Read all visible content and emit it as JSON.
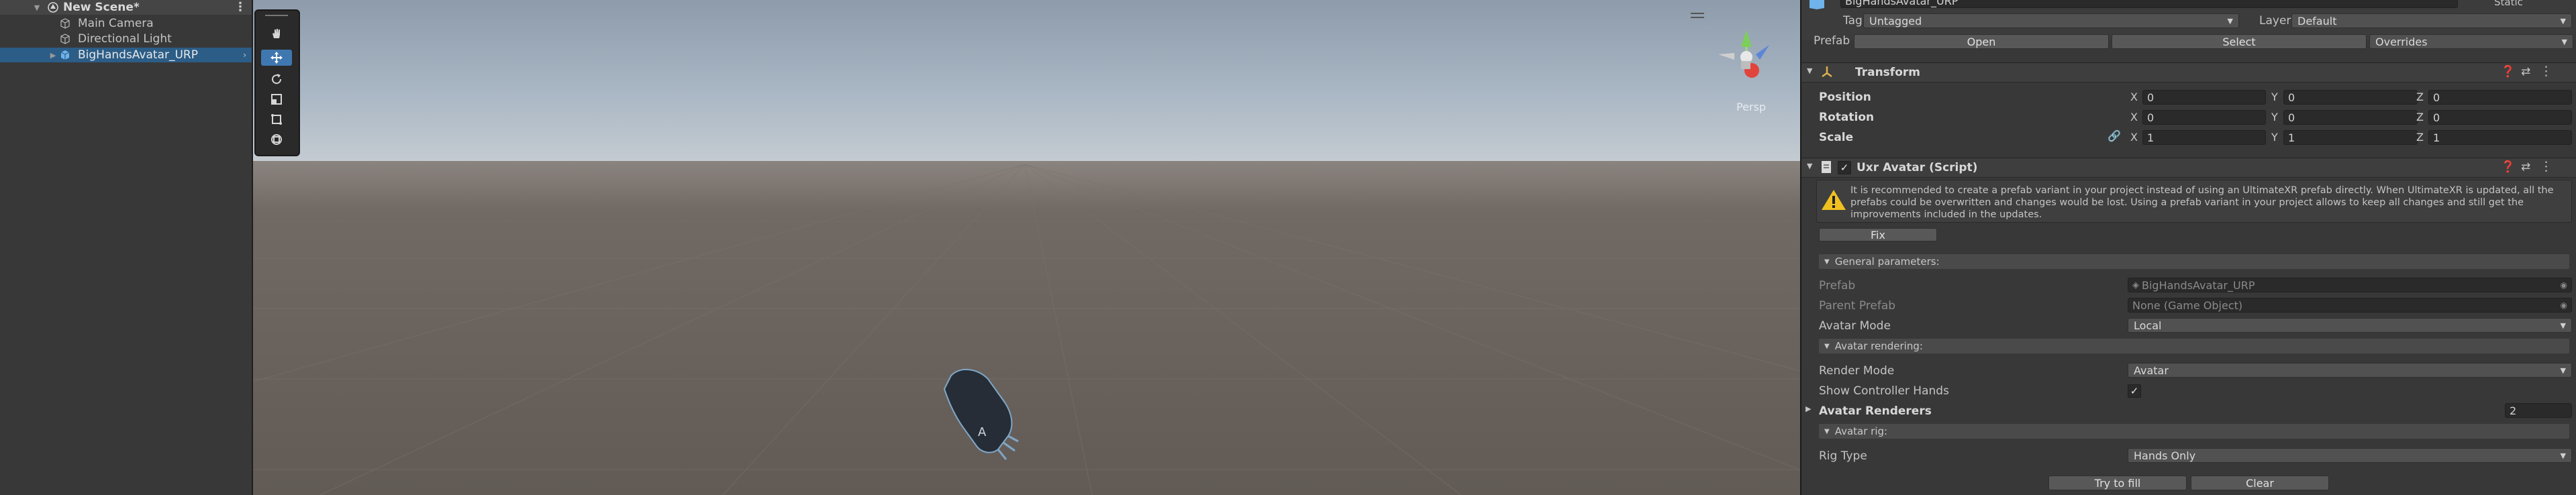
{
  "hierarchy": {
    "scene_name": "New Scene*",
    "items": [
      {
        "label": "Main Camera"
      },
      {
        "label": "Directional Light"
      },
      {
        "label": "BigHandsAvatar_URP"
      }
    ]
  },
  "scene_view": {
    "persp_label": "Persp"
  },
  "inspector": {
    "object_name": "BigHandsAvatar_URP",
    "static_label": "Static",
    "tag_label": "Tag",
    "tag_value": "Untagged",
    "layer_label": "Layer",
    "layer_value": "Default",
    "prefab_label": "Prefab",
    "prefab_open": "Open",
    "prefab_select": "Select",
    "prefab_overrides": "Overrides",
    "transform": {
      "title": "Transform",
      "position_label": "Position",
      "rotation_label": "Rotation",
      "scale_label": "Scale",
      "x": "X",
      "y": "Y",
      "z": "Z",
      "position": {
        "x": "0",
        "y": "0",
        "z": "0"
      },
      "rotation": {
        "x": "0",
        "y": "0",
        "z": "0"
      },
      "scale": {
        "x": "1",
        "y": "1",
        "z": "1"
      }
    },
    "script": {
      "title": "Uxr Avatar (Script)",
      "warning": "It is recommended to create a prefab variant in your project instead of using an UltimateXR prefab directly. When UltimateXR is updated, all the prefabs could be overwritten and changes would be lost. Using a prefab variant in your project allows to keep all changes and still get the improvements included in the updates.",
      "fix_label": "Fix",
      "general_parameters": "General parameters:",
      "prefab_label": "Prefab",
      "prefab_value": "BigHandsAvatar_URP",
      "parent_prefab_label": "Parent Prefab",
      "parent_prefab_value": "None (Game Object)",
      "avatar_mode_label": "Avatar Mode",
      "avatar_mode_value": "Local",
      "avatar_rendering": "Avatar rendering:",
      "render_mode_label": "Render Mode",
      "render_mode_value": "Avatar",
      "show_controller_hands_label": "Show Controller Hands",
      "avatar_renderers_label": "Avatar Renderers",
      "avatar_renderers_count": "2",
      "avatar_rig": "Avatar rig:",
      "rig_type_label": "Rig Type",
      "rig_type_value": "Hands Only",
      "try_to_fill": "Try to fill",
      "clear": "Clear"
    }
  },
  "colors": {
    "selection": "#2c5d87",
    "panel": "#383838",
    "sky": "#a9b6c4",
    "ground": "#6e6660",
    "accent_blue": "#3f78b0",
    "warning": "#f0c020"
  }
}
